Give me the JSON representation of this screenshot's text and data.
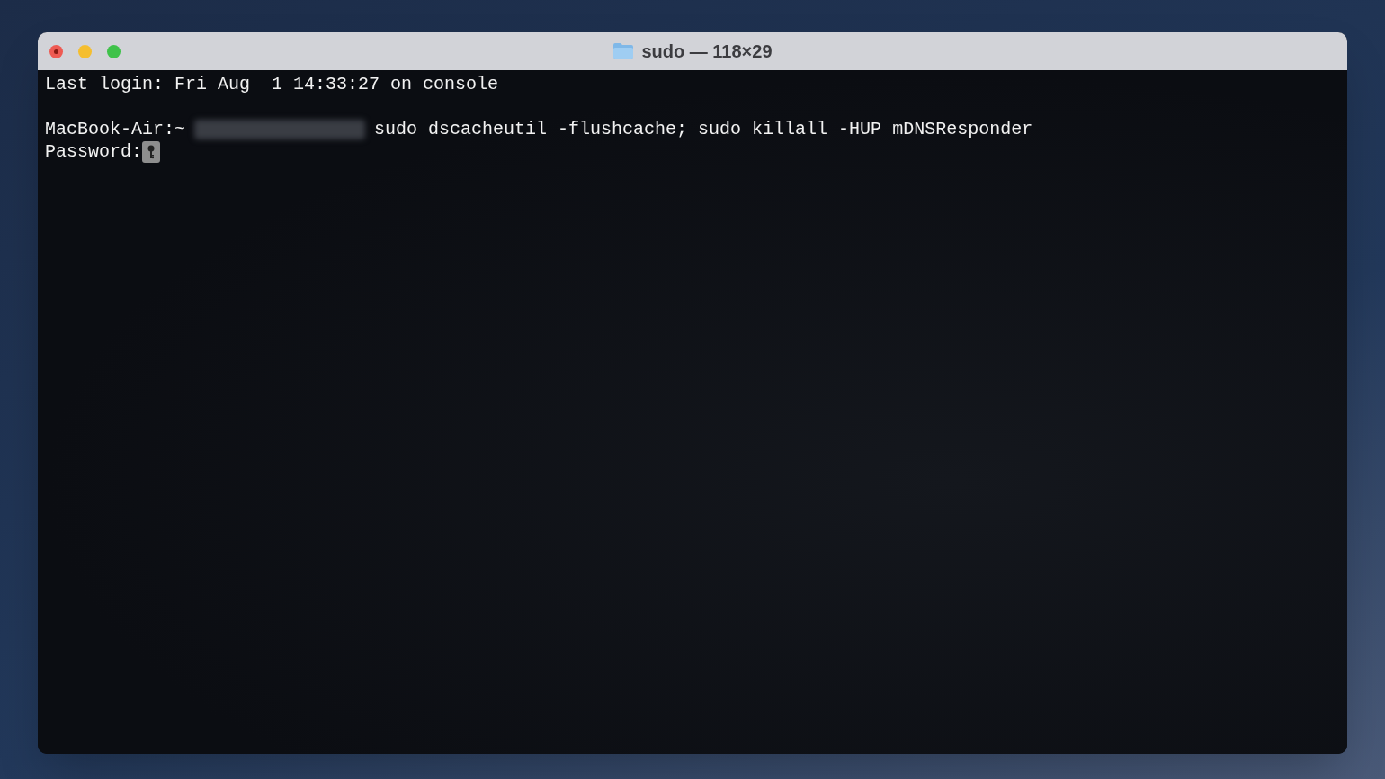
{
  "window": {
    "title": "sudo — 118×29"
  },
  "lines": [
    {
      "kind": "text",
      "text": "Last login: Fri Aug  1 14:33:27 on console"
    },
    {
      "kind": "blank"
    },
    {
      "kind": "prompt",
      "prompt": "MacBook-Air:~",
      "command": "sudo dscacheutil -flushcache; sudo killall -HUP mDNSResponder"
    },
    {
      "kind": "password",
      "text": "Password:"
    }
  ]
}
